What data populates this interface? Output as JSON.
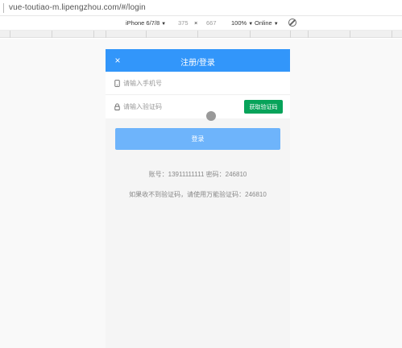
{
  "browser": {
    "url": "vue-toutiao-m.lipengzhou.com/#/login"
  },
  "device_toolbar": {
    "device": "iPhone 6/7/8",
    "width": "375",
    "times": "×",
    "height": "667",
    "zoom": "100%",
    "network": "Online"
  },
  "app": {
    "nav": {
      "close_icon": "×",
      "title": "注册/登录"
    },
    "form": {
      "phone_placeholder": "请输入手机号",
      "code_placeholder": "请输入验证码",
      "send_code_label": "获取验证码"
    },
    "login_label": "登录",
    "hints": {
      "account": "账号：13911111111 密码：246810",
      "universal": "如果收不到验证码，请使用万能验证码：246810"
    }
  },
  "colors": {
    "primary": "#3296fa",
    "login_button": "#6eb4fb",
    "send_code_button": "#07a35a",
    "page_bg": "#f5f5f5"
  }
}
